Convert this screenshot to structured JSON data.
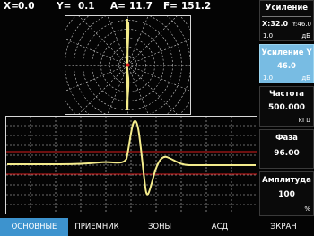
{
  "header": {
    "x_label": "X=",
    "x_value": "0.0",
    "y_label": "Y=",
    "y_value": "0.1",
    "a_label": "A=",
    "a_value": "11.7",
    "f_label": "F=",
    "f_value": "151.2"
  },
  "side_panel": {
    "gain": {
      "title": "Усиление",
      "x_label": "X:32.0",
      "y_label": "Y:46.0",
      "step": "1.0",
      "unit": "дБ"
    },
    "gain_y": {
      "title": "Усиление Y",
      "value": "46.0",
      "step": "1.0",
      "unit": "дБ"
    },
    "frequency": {
      "title": "Частота",
      "value": "500.000",
      "unit": "кГц"
    },
    "phase": {
      "title": "Фаза",
      "value": "96.00"
    },
    "amplitude": {
      "title": "Амплитуда",
      "value": "100",
      "unit": "%"
    }
  },
  "menu": {
    "items": [
      "ОСНОВНЫЕ",
      "ПРИЕМНИК",
      "ЗОНЫ",
      "АСД",
      "ЭКРАН"
    ],
    "active": "ОСНОВНЫЕ"
  },
  "colors": {
    "background": "#040404",
    "grid": "#cfcfcf",
    "signal": "#f4ec8c",
    "threshold": "#d81c1c",
    "active_panel": "#78bce3",
    "active_menu": "#3d93ce"
  }
}
